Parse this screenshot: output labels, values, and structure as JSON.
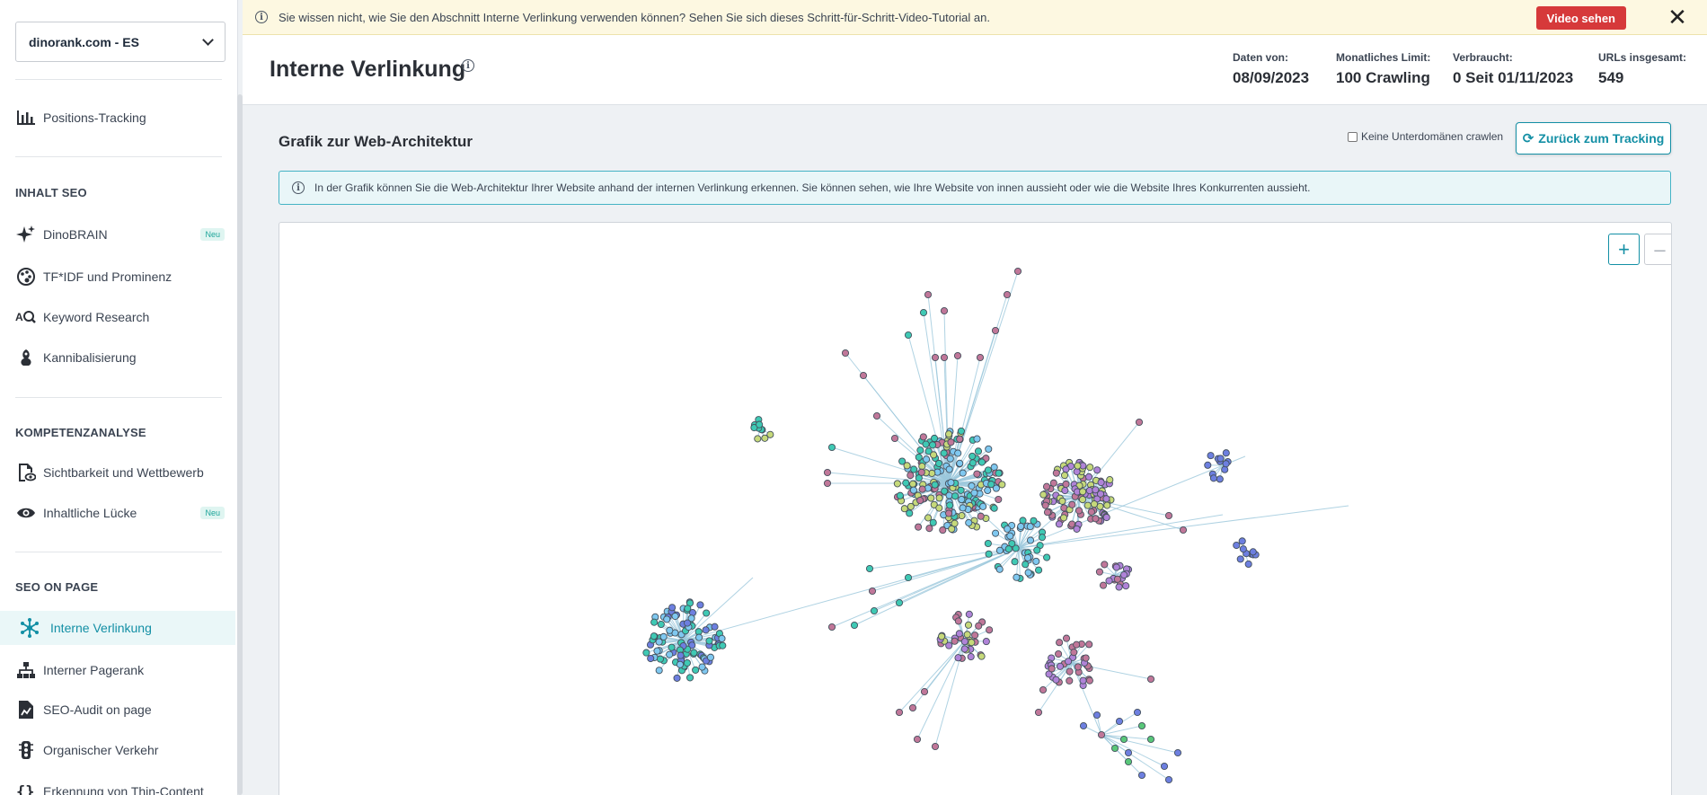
{
  "sidebar": {
    "project": "dinorank.com - ES",
    "positions_tracking": "Positions-Tracking",
    "sections": [
      {
        "title": "INHALT SEO",
        "items": [
          {
            "label": "DinoBRAIN",
            "badge": "Neu",
            "icon": "sparkle-icon"
          },
          {
            "label": "TF*IDF und Prominenz",
            "icon": "palette-icon"
          },
          {
            "label": "Keyword Research",
            "icon": "keyword-search-icon"
          },
          {
            "label": "Kannibalisierung",
            "icon": "cannibal-icon"
          }
        ]
      },
      {
        "title": "KOMPETENZANALYSE",
        "items": [
          {
            "label": "Sichtbarkeit und Wettbewerb",
            "icon": "document-eye-icon"
          },
          {
            "label": "Inhaltliche Lücke",
            "badge": "Neu",
            "icon": "eye-icon"
          }
        ]
      },
      {
        "title": "SEO ON PAGE",
        "items": [
          {
            "label": "Interne Verlinkung",
            "icon": "network-icon",
            "active": true
          },
          {
            "label": "Interner Pagerank",
            "icon": "hierarchy-icon"
          },
          {
            "label": "SEO-Audit on page",
            "icon": "document-chart-icon"
          },
          {
            "label": "Organischer Verkehr",
            "icon": "traffic-light-icon"
          },
          {
            "label": "Erkennung von Thin-Content",
            "icon": "braces-icon"
          }
        ]
      }
    ]
  },
  "banner": {
    "text": "Sie wissen nicht, wie Sie den Abschnitt Interne Verlinkung verwenden können? Sehen Sie sich dieses Schritt-für-Schritt-Video-Tutorial an.",
    "video_button": "Video sehen",
    "close": "✕"
  },
  "header": {
    "title": "Interne Verlinkung",
    "stats": [
      {
        "label": "Daten von:",
        "value": "08/09/2023"
      },
      {
        "label": "Monatliches Limit:",
        "value": "100 Crawling"
      },
      {
        "label": "Verbraucht:",
        "value": "0 Seit 01/11/2023"
      },
      {
        "label": "URLs insgesamt:",
        "value": "549"
      }
    ]
  },
  "content": {
    "section_title": "Grafik zur Web-Architektur",
    "checkbox_label": "Keine Unterdomänen crawlen",
    "back_button": "Zurück zum Tracking",
    "info_text": "In der Grafik können Sie die Web-Architektur Ihrer Website anhand der internen Verlinkung erkennen. Sie können sehen, wie Ihre Website von innen aussieht oder wie die Website Ihres Konkurrenten aussieht.",
    "zoom_in": "+",
    "zoom_out": "–"
  },
  "colors": {
    "accent": "#138fa5",
    "danger": "#d6393a",
    "node_colors": [
      "#3fc9b4",
      "#7fc8f0",
      "#c6d97a",
      "#c07799",
      "#b083d8",
      "#6d7fe0",
      "#59c779"
    ]
  }
}
